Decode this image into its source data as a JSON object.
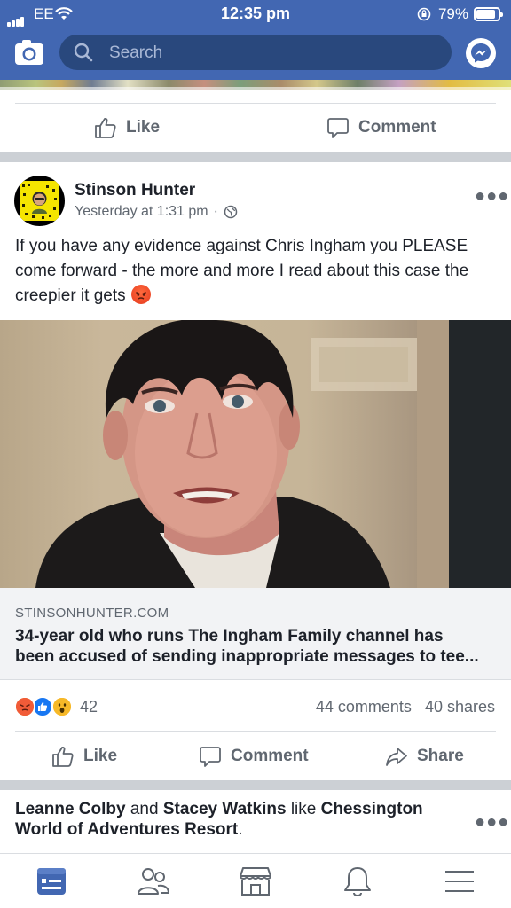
{
  "status_bar": {
    "carrier": "EE",
    "time": "12:35 pm",
    "battery": "79%"
  },
  "header": {
    "search_placeholder": "Search"
  },
  "prev_post": {
    "like_label": "Like",
    "comment_label": "Comment"
  },
  "post": {
    "author": "Stinson Hunter",
    "timestamp": "Yesterday at 1:31 pm",
    "privacy_icon": "globe-icon",
    "text": "If you have any evidence against Chris Ingham you PLEASE come forward - the more and more I read about this case the creepier it gets",
    "link": {
      "domain": "STINSONHUNTER.COM",
      "title_line1": "34-year old who runs The Ingham Family channel has",
      "title_line2": "been accused of sending inappropriate messages to tee..."
    },
    "reactions": {
      "types": [
        "angry",
        "like",
        "wow"
      ],
      "count": "42"
    },
    "comments": "44 comments",
    "shares": "40 shares",
    "actions": {
      "like": "Like",
      "comment": "Comment",
      "share": "Share"
    }
  },
  "next_post": {
    "person1": "Leanne Colby",
    "and": "and",
    "person2": "Stacey Watkins",
    "like_word": "like",
    "page_line1": "Chessington",
    "page_line2": "World of Adventures Resort",
    "period": "."
  },
  "bottom_nav": [
    "news-feed-icon",
    "friends-icon",
    "marketplace-icon",
    "notifications-icon",
    "menu-icon"
  ],
  "colors": {
    "brand": "#4267b2",
    "search_bg": "#29487d",
    "secondary_text": "#606770"
  }
}
